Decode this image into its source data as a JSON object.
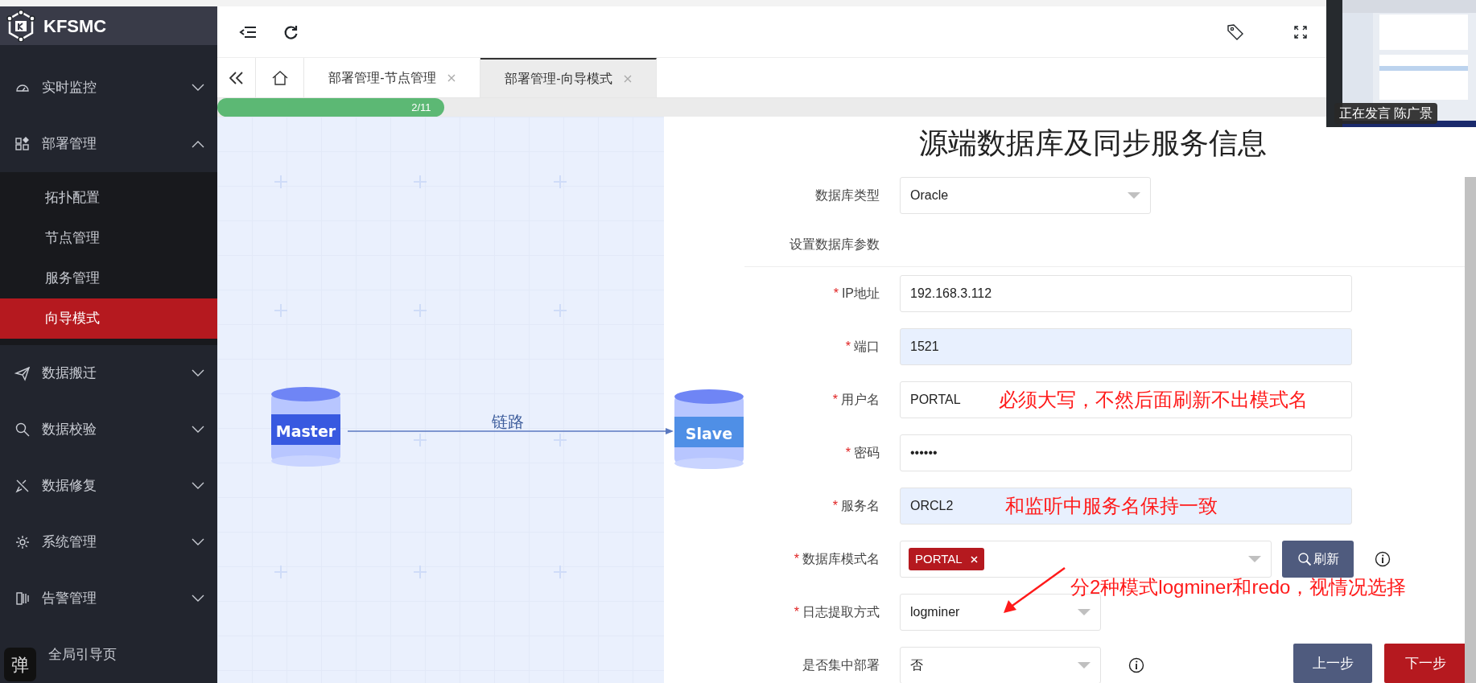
{
  "app": {
    "name": "KFSMC"
  },
  "sidebar": {
    "items": [
      {
        "kind": "group",
        "label": "实时监控",
        "expanded": false
      },
      {
        "kind": "group",
        "label": "部署管理",
        "expanded": true,
        "children": [
          {
            "label": "拓扑配置",
            "selected": false
          },
          {
            "label": "节点管理",
            "selected": false
          },
          {
            "label": "服务管理",
            "selected": false
          },
          {
            "label": "向导模式",
            "selected": true
          }
        ]
      },
      {
        "kind": "group",
        "label": "数据搬迁",
        "expanded": false
      },
      {
        "kind": "group",
        "label": "数据校验",
        "expanded": false
      },
      {
        "kind": "group",
        "label": "数据修复",
        "expanded": false
      },
      {
        "kind": "group",
        "label": "系统管理",
        "expanded": false
      },
      {
        "kind": "group",
        "label": "告警管理",
        "expanded": false
      },
      {
        "kind": "link",
        "label": "全局引导页"
      }
    ],
    "floating_widget": "弹"
  },
  "tabs": [
    {
      "kind": "home",
      "selected": false
    },
    {
      "kind": "page",
      "label": "部署管理-节点管理",
      "selected": false
    },
    {
      "kind": "page",
      "label": "部署管理-向导模式",
      "selected": true
    }
  ],
  "progress": {
    "level": 0.18,
    "label": "2/11"
  },
  "diagram": {
    "nodes": [
      {
        "label": "Master"
      },
      {
        "label": "Slave"
      }
    ],
    "link_label": "链路"
  },
  "form": {
    "title": "源端数据库及同步服务信息",
    "required_mark": "*",
    "fields": [
      {
        "kind": "select",
        "label": "数据库类型",
        "required": false,
        "value": "Oracle"
      },
      {
        "kind": "section",
        "label": "设置数据库参数"
      },
      {
        "kind": "input",
        "label": "IP地址",
        "required": true,
        "value": "192.168.3.112",
        "autofilled": false
      },
      {
        "kind": "input",
        "label": "端口",
        "required": true,
        "value": "1521",
        "autofilled": true
      },
      {
        "kind": "input",
        "label": "用户名",
        "required": true,
        "value": "PORTAL",
        "autofilled": false
      },
      {
        "kind": "input",
        "label": "密码",
        "required": true,
        "value": "••••••",
        "autofilled": false
      },
      {
        "kind": "input",
        "label": "服务名",
        "required": true,
        "value": "ORCL2",
        "autofilled": true
      },
      {
        "kind": "tags",
        "label": "数据库模式名",
        "required": true,
        "tags": [
          "PORTAL"
        ],
        "action": "刷新",
        "info": true
      },
      {
        "kind": "select",
        "label": "日志提取方式",
        "required": true,
        "value": "logminer"
      },
      {
        "kind": "select",
        "label": "是否集中部署",
        "required": false,
        "value": "否",
        "info": true
      }
    ],
    "buttons": [
      {
        "kind": "secondary",
        "label": "上一步"
      },
      {
        "kind": "primary",
        "label": "下一步"
      }
    ]
  },
  "annotations": [
    {
      "text": "必须大写，不然后面刷新不出模式名",
      "arrow": false
    },
    {
      "text": "和监听中服务名保持一致",
      "arrow": false
    },
    {
      "text": "分2种模式logminer和redo，视情况选择",
      "arrow": true
    }
  ],
  "video": {
    "caption": "正在发言 陈广景"
  }
}
